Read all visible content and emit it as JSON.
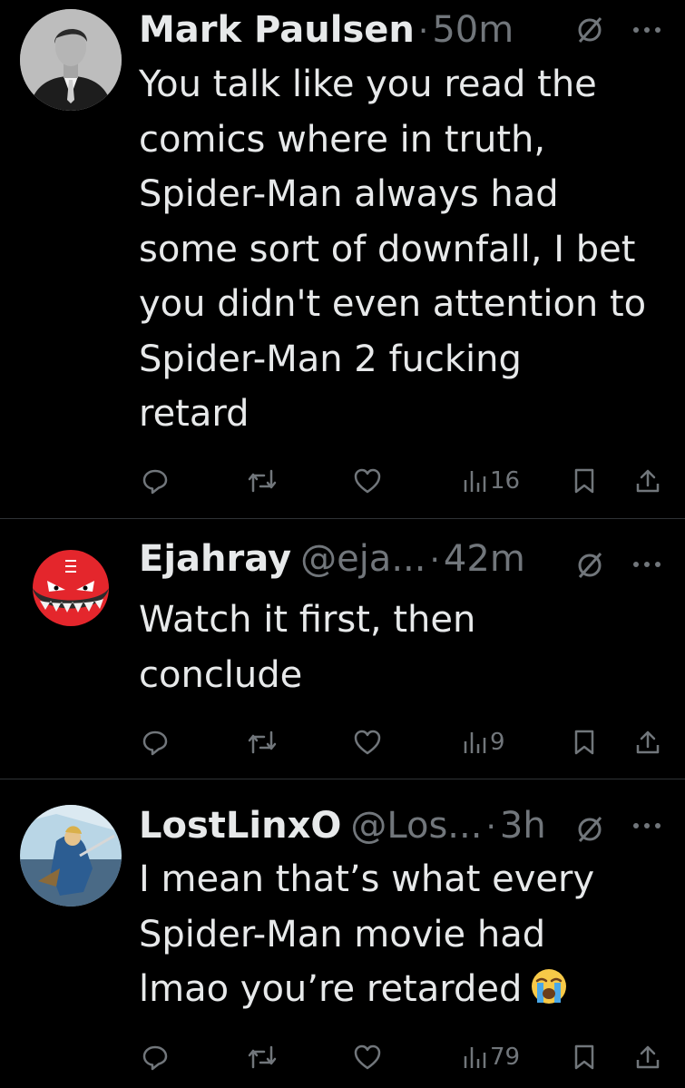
{
  "tweets": [
    {
      "name": "Mark Paulsen",
      "handle": "",
      "time": "50m",
      "lines": [
        "You talk like you read the",
        "comics where in truth,",
        "Spider-Man always had",
        "some sort of downfall, I bet",
        "you didn't even attention to",
        "Spider-Man 2 fucking",
        "retard"
      ],
      "views": "16"
    },
    {
      "name": "Ejahray",
      "handle": "@eja...",
      "time": "42m",
      "lines": [
        "Watch it first, then",
        "conclude"
      ],
      "views": "9"
    },
    {
      "name": "LostLinxO",
      "handle": "@Los...",
      "time": "3h",
      "lines": [
        "I mean that’s what every",
        "Spider-Man movie had",
        "lmao you’re retarded"
      ],
      "emoji": "loudly-crying-face-emoji",
      "views": "79"
    }
  ],
  "separator": "·",
  "icons": {
    "reply": "reply-icon",
    "retweet": "retweet-icon",
    "like": "heart-icon",
    "views": "views-bar-chart-icon",
    "bookmark": "bookmark-icon",
    "share": "share-icon",
    "mute": "muted-circle-slash-icon",
    "more": "more-dots-icon"
  },
  "colors": {
    "background": "#000000",
    "text": "#e7e9ea",
    "secondary": "#71767b",
    "divider": "#2f3336"
  }
}
